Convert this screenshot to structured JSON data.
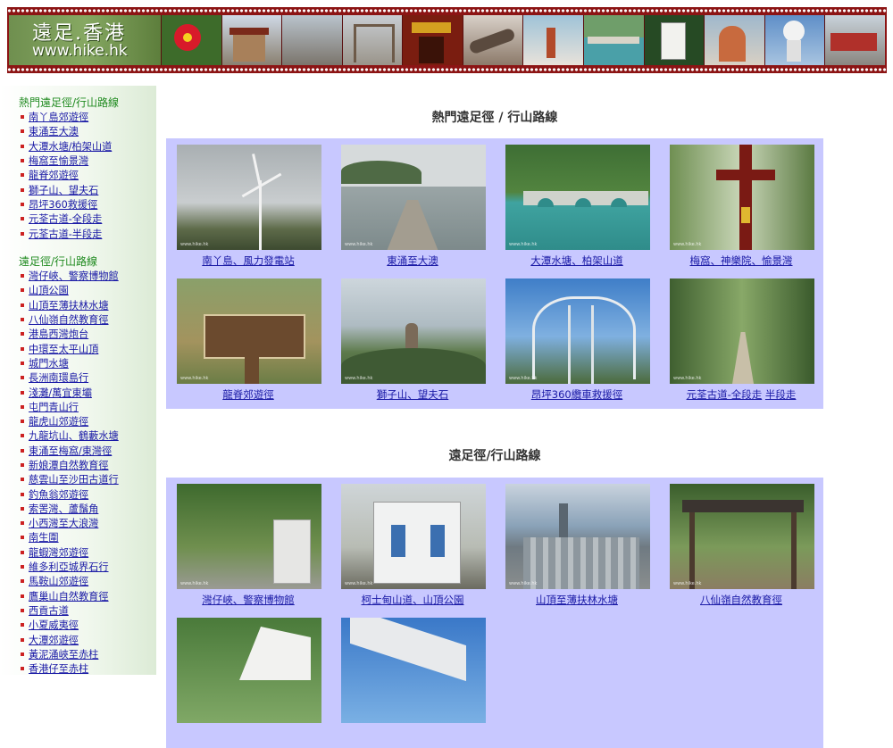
{
  "banner": {
    "logo_line1": "遠足.香港",
    "logo_line2": "www.hike.hk"
  },
  "sidebar": {
    "groups": [
      {
        "title": "熱門遠足徑/行山路線",
        "items": [
          "南丫島郊遊徑",
          "東涌至大澳",
          "大潭水塘/柏架山道",
          "梅窩至愉景灣",
          "龍脊郊遊徑",
          "獅子山、望夫石",
          "昂坪360救援徑",
          "元荃古道-全段走",
          "元荃古道-半段走"
        ]
      },
      {
        "title": "遠足徑/行山路線",
        "items": [
          "灣仔峽、警察博物館",
          "山頂公園",
          "山頂至薄扶林水塘",
          "八仙嶺自然教育徑",
          "港島西灣炮台",
          "中環至太平山頂",
          "城門水塘",
          "長洲南環島行",
          "淺灘/萬宜東壩",
          "屯門青山行",
          "龍虎山郊遊徑",
          "九龍坑山、鶴藪水塘",
          "東涌至梅窩/東灣徑",
          "新娘潭自然教育徑",
          "慈雲山至沙田古道行",
          "釣魚翁郊遊徑",
          "索罟灣、蘆鬚角",
          "小西灣至大浪灣",
          "南生圍",
          "龍蝦灣郊遊徑",
          "維多利亞城界石行",
          "馬鞍山郊遊徑",
          "鷹巢山自然教育徑",
          "西貢古道",
          "小夏威夷徑",
          "大潭郊遊徑",
          "黃泥涌峽至赤柱",
          "香港仔至赤柱"
        ]
      }
    ]
  },
  "main": {
    "popular_title": "熱門遠足徑 / 行山路線",
    "popular": [
      {
        "caption": "南丫島、風力發電站"
      },
      {
        "caption": "東涌至大澳"
      },
      {
        "caption": "大潭水塘、柏架山道"
      },
      {
        "caption": "梅窩、神樂院、愉景灣"
      },
      {
        "caption": "龍脊郊遊徑"
      },
      {
        "caption": "獅子山、望夫石"
      },
      {
        "caption": "昂坪360纜車救援徑"
      },
      {
        "caption": "元荃古道-全段走",
        "caption2": "半段走"
      }
    ],
    "trails_title": "遠足徑/行山路線",
    "trails": [
      {
        "caption": "灣仔峽、警察博物館"
      },
      {
        "caption": "柯士甸山道、山頂公園"
      },
      {
        "caption": "山頂至薄扶林水塘"
      },
      {
        "caption": "八仙嶺自然教育徑"
      }
    ],
    "watermark": "www.hike.hk"
  },
  "colors": {
    "banner_bg": "#8c1414",
    "grid_bg": "#c8c8ff",
    "link": "#1a1aa6",
    "sidebar_head": "#1f8a1f",
    "bullet": "#cc2222"
  }
}
